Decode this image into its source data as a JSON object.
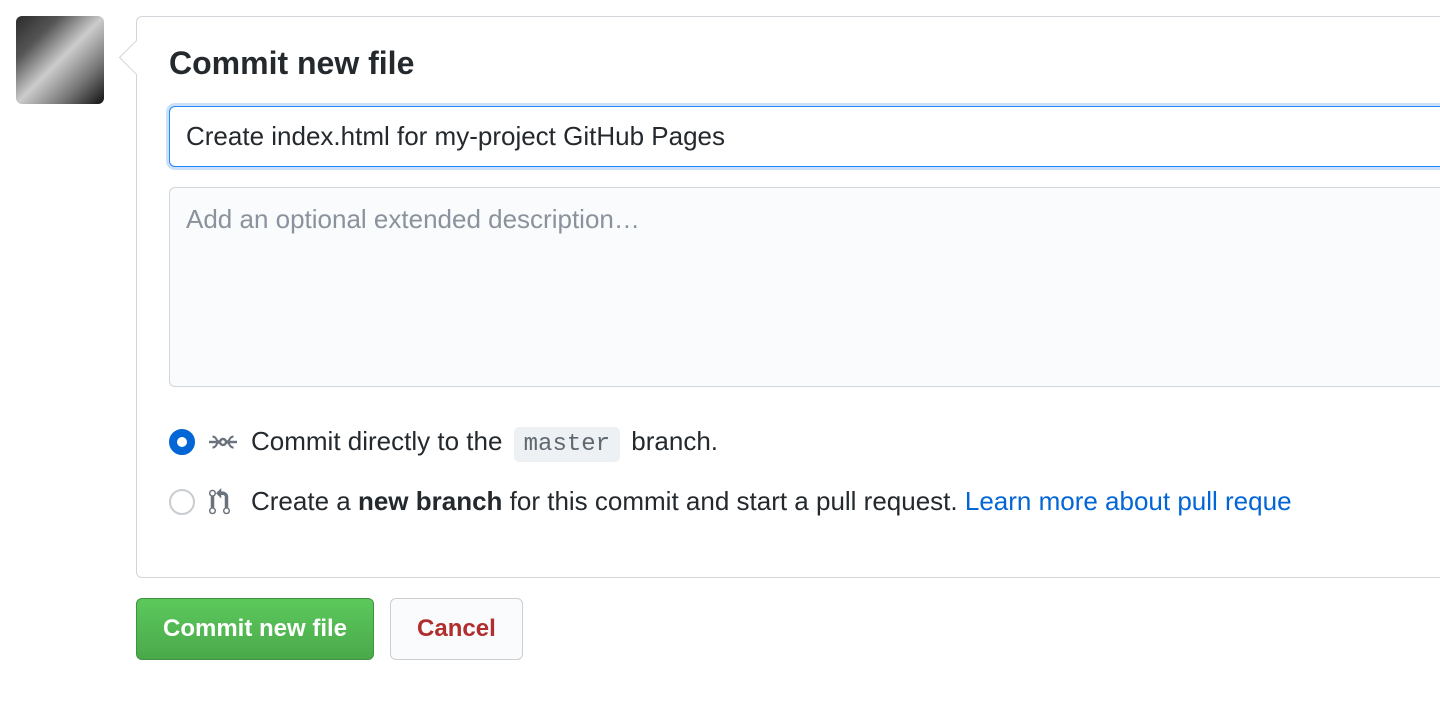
{
  "panel": {
    "title": "Commit new file",
    "summary_value": "Create index.html for my-project GitHub Pages",
    "description_placeholder": "Add an optional extended description…"
  },
  "options": {
    "direct": {
      "prefix": "Commit directly to the",
      "branch": "master",
      "suffix": "branch."
    },
    "newbranch": {
      "t1": "Create a ",
      "bold": "new branch",
      "t2": " for this commit and start a pull request. ",
      "link": "Learn more about pull reque"
    }
  },
  "actions": {
    "commit": "Commit new file",
    "cancel": "Cancel"
  }
}
